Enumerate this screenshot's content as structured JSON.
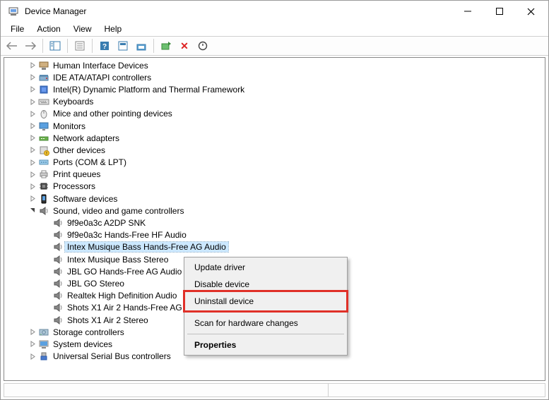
{
  "window": {
    "title": "Device Manager"
  },
  "menu": {
    "file": "File",
    "action": "Action",
    "view": "View",
    "help": "Help"
  },
  "categories": [
    {
      "label": "Human Interface Devices",
      "icon": "hid"
    },
    {
      "label": "IDE ATA/ATAPI controllers",
      "icon": "ide"
    },
    {
      "label": "Intel(R) Dynamic Platform and Thermal Framework",
      "icon": "intel"
    },
    {
      "label": "Keyboards",
      "icon": "keyboard"
    },
    {
      "label": "Mice and other pointing devices",
      "icon": "mouse"
    },
    {
      "label": "Monitors",
      "icon": "monitor"
    },
    {
      "label": "Network adapters",
      "icon": "network"
    },
    {
      "label": "Other devices",
      "icon": "other"
    },
    {
      "label": "Ports (COM & LPT)",
      "icon": "port"
    },
    {
      "label": "Print queues",
      "icon": "printer"
    },
    {
      "label": "Processors",
      "icon": "cpu"
    },
    {
      "label": "Software devices",
      "icon": "software"
    }
  ],
  "sound_category": {
    "label": "Sound, video and game controllers",
    "children": [
      "9f9e0a3c A2DP SNK",
      "9f9e0a3c Hands-Free HF Audio",
      "Intex Musique Bass Hands-Free AG Audio",
      "Intex Musique Bass Stereo",
      "JBL GO Hands-Free AG Audio",
      "JBL GO Stereo",
      "Realtek High Definition Audio",
      "Shots X1 Air 2 Hands-Free AG Audio",
      "Shots X1 Air 2 Stereo"
    ],
    "selected_index": 2
  },
  "categories_after": [
    {
      "label": "Storage controllers",
      "icon": "storage"
    },
    {
      "label": "System devices",
      "icon": "system"
    },
    {
      "label": "Universal Serial Bus controllers",
      "icon": "usb"
    }
  ],
  "context_menu": {
    "update": "Update driver",
    "disable": "Disable device",
    "uninstall": "Uninstall device",
    "scan": "Scan for hardware changes",
    "properties": "Properties"
  }
}
